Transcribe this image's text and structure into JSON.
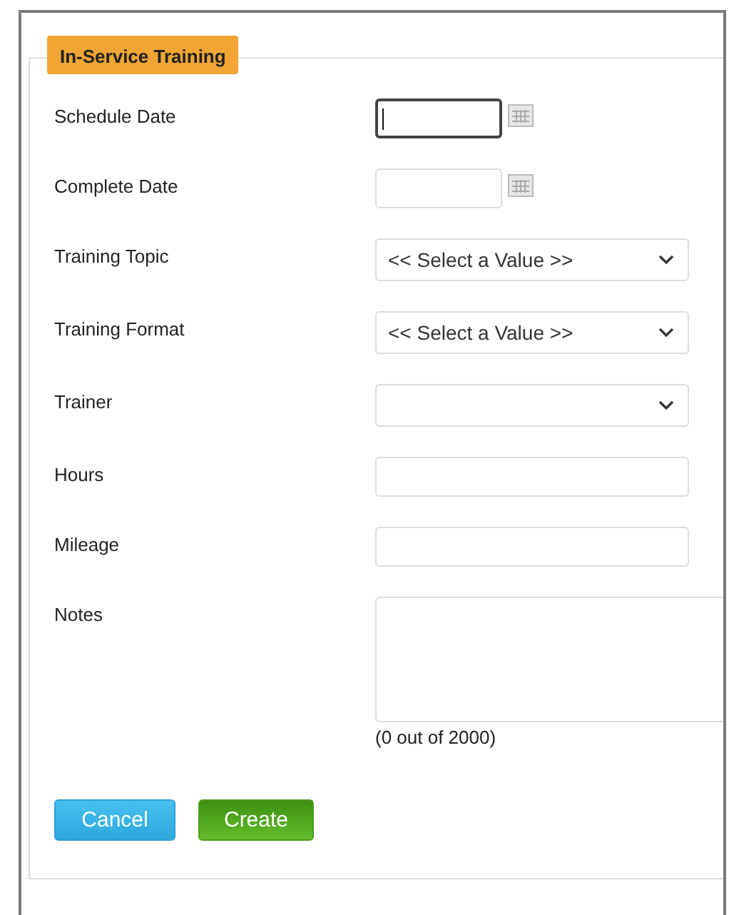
{
  "section": {
    "title": "In-Service Training"
  },
  "fields": [
    {
      "label": "Schedule Date",
      "kind": "date",
      "focused": true
    },
    {
      "label": "Complete Date",
      "kind": "date",
      "focused": false
    },
    {
      "label": "Training Topic",
      "kind": "select",
      "value": "<< Select a Value >>",
      "focused": false
    },
    {
      "label": "Training Format",
      "kind": "select",
      "value": "<< Select a Value >>",
      "focused": false
    },
    {
      "label": "Trainer",
      "kind": "select",
      "focused": false
    },
    {
      "label": "Hours",
      "kind": "text",
      "focused": false
    },
    {
      "label": "Mileage",
      "kind": "text",
      "focused": false
    },
    {
      "label": "Notes",
      "kind": "textarea",
      "counter": "(0 out of 2000)",
      "focused": false
    }
  ],
  "buttons": [
    {
      "label": "Cancel",
      "kind": "secondary"
    },
    {
      "label": "Create",
      "kind": "primary"
    }
  ]
}
